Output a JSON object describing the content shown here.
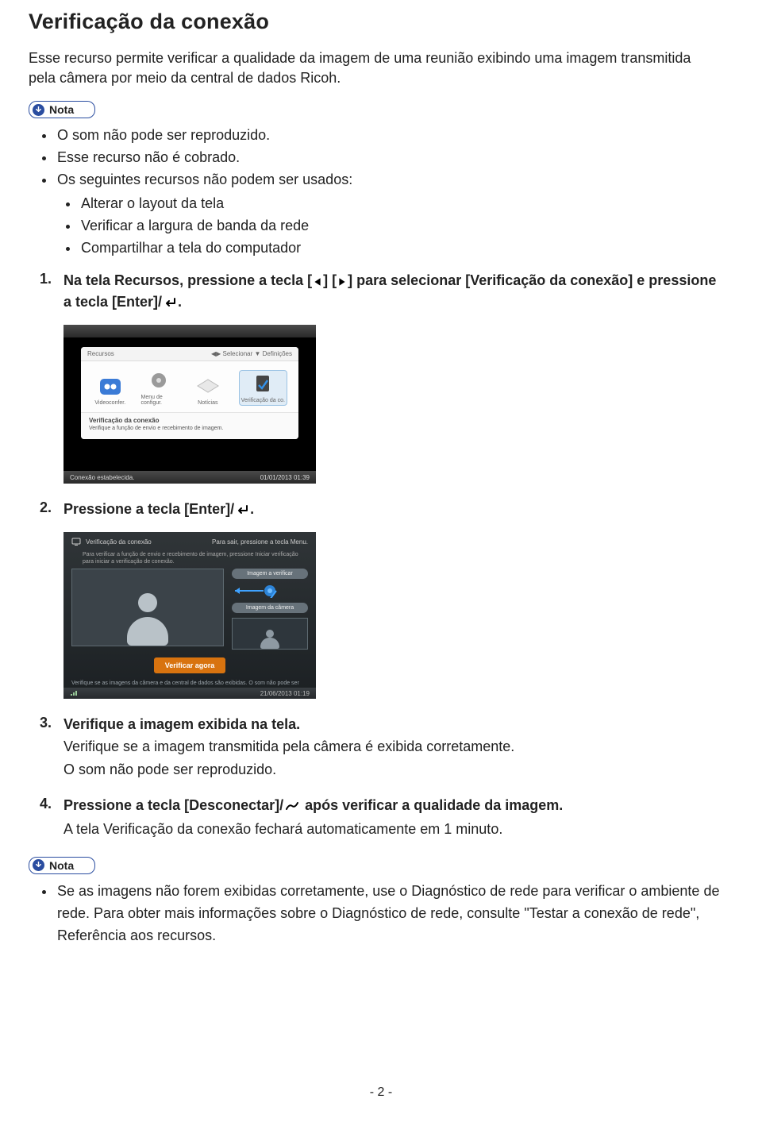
{
  "title": "Verificação da conexão",
  "intro": "Esse recurso permite verificar a qualidade da imagem de uma reunião exibindo uma imagem transmitida pela câmera por meio da central de dados Ricoh.",
  "nota_label": "Nota",
  "nota1": {
    "b1": "O som não pode ser reproduzido.",
    "b2": "Esse recurso não é cobrado.",
    "b3": "Os seguintes recursos não podem ser usados:",
    "s1": "Alterar o layout da tela",
    "s2": "Verificar a largura de banda da rede",
    "s3": "Compartilhar a tela do computador"
  },
  "step1": {
    "p1": "Na tela Recursos, pressione a tecla [",
    "p2": "] [",
    "p3": "] para selecionar [Verificação da conexão] e pressione a tecla [Enter]/",
    "p4": "."
  },
  "mock1": {
    "toolbarTitle": "Recursos",
    "toolbarRight": "◀▶ Selecionar ▼ Definições",
    "i1": "Videoconfer.",
    "i2": "Menu de configur.",
    "i3": "Notícias",
    "i4": "Verificação da co.",
    "descTitle": "Verificação da conexão",
    "descSub": "Verifique a função de envio e recebimento de imagem.",
    "statusLeft": "Conexão estabelecida.",
    "statusRight": "01/01/2013 01:39"
  },
  "step2": {
    "p1": "Pressione a tecla [Enter]/",
    "p2": "."
  },
  "mock2": {
    "title": "Verificação da conexão",
    "titleRight": "Para sair, pressione a tecla Menu.",
    "hint": "Para verificar a função de envio e recebimento de imagem, pressione Iniciar verificação para iniciar a verificação de conexão.",
    "pill1": "Imagem a verificar",
    "pill2": "Imagem da câmera",
    "btn": "Verificar agora",
    "foot": "Verifique se as imagens da câmera e da central de dados são exibidas. O som não pode ser reproduzido.",
    "barRight": "21/06/2013 01:19"
  },
  "step3": {
    "head": "Verifique a imagem exibida na tela.",
    "l1": "Verifique se a imagem transmitida pela câmera é exibida corretamente.",
    "l2": "O som não pode ser reproduzido."
  },
  "step4": {
    "h1": "Pressione a tecla [Desconectar]/",
    "h2": " após verificar a qualidade da imagem.",
    "l1": "A tela Verificação da conexão fechará automaticamente em 1 minuto."
  },
  "nota2": {
    "b1": "Se as imagens não forem exibidas corretamente, use o Diagnóstico de rede para verificar o ambiente de rede. Para obter mais informações sobre o Diagnóstico de rede, consulte \"Testar a conexão de rede\", Referência aos recursos."
  },
  "page_number": "- 2 -"
}
